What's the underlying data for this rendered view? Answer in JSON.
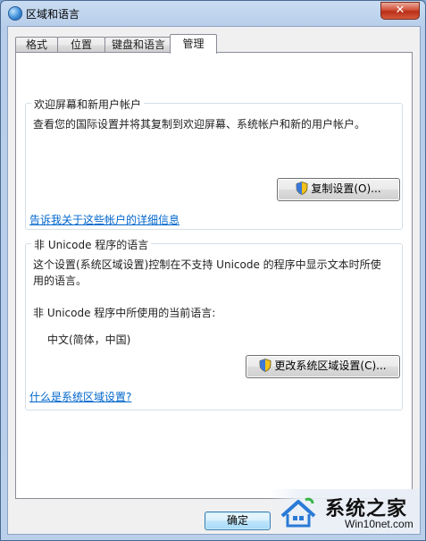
{
  "window": {
    "title": "区域和语言"
  },
  "tabs": [
    {
      "label": "格式"
    },
    {
      "label": "位置"
    },
    {
      "label": "键盘和语言"
    },
    {
      "label": "管理",
      "active": true
    }
  ],
  "welcome_group": {
    "title": "欢迎屏幕和新用户帐户",
    "description": "查看您的国际设置并将其复制到欢迎屏幕、系统帐户和新的用户帐户。",
    "copy_button": "复制设置(O)...",
    "link": "告诉我关于这些帐户的详细信息"
  },
  "unicode_group": {
    "title": "非 Unicode 程序的语言",
    "description_line1": "这个设置(系统区域设置)控制在不支持 Unicode 的程序中显示文本时所使",
    "description_line2": "用的语言。",
    "current_label": "非 Unicode 程序中所使用的当前语言:",
    "current_value": "中文(简体，中国)",
    "change_button": "更改系统区域设置(C)...",
    "link": "什么是系统区域设置?"
  },
  "footer": {
    "ok_button": "确定"
  },
  "watermark": {
    "name": "系统之家",
    "url": "Win10net.com"
  },
  "colors": {
    "accent": "#0066cc",
    "titlebar": "#c9dcf2",
    "close": "#c8432a"
  }
}
